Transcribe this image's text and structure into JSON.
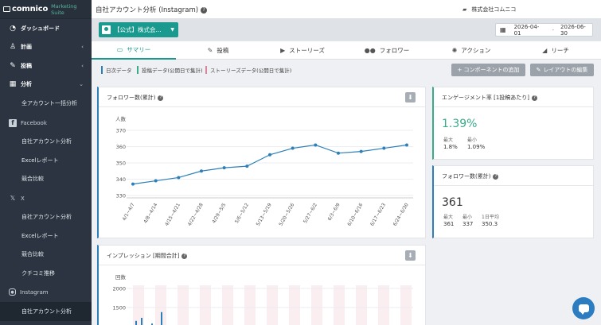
{
  "sidebar": {
    "logo": "comnico",
    "logo_sub": "Marketing Suite",
    "items": [
      {
        "label": "ダッシュボード",
        "icon": "dashboard-icon"
      },
      {
        "label": "計画",
        "icon": "plan-icon"
      },
      {
        "label": "投稿",
        "icon": "post-icon"
      },
      {
        "label": "分析",
        "icon": "analytics-icon"
      },
      {
        "label": "全アカウント一括分析"
      },
      {
        "label": "Facebook",
        "icon": "facebook-icon"
      },
      {
        "label": "自社アカウント分析"
      },
      {
        "label": "Excelレポート"
      },
      {
        "label": "競合比較"
      },
      {
        "label": "X",
        "icon": "x-icon"
      },
      {
        "label": "自社アカウント分析"
      },
      {
        "label": "Excelレポート"
      },
      {
        "label": "競合比較"
      },
      {
        "label": "クチコミ推移"
      },
      {
        "label": "Instagram",
        "icon": "instagram-icon"
      },
      {
        "label": "自社アカウント分析"
      }
    ]
  },
  "header": {
    "title": "自社アカウント分析 (Instagram)",
    "company": "株式会社コムニコ"
  },
  "toolbar": {
    "account_label": "【公式】株式会...",
    "date_from": "2026-04-01",
    "date_sep": "-",
    "date_to": "2026-06-30"
  },
  "tabs": [
    {
      "label": "サマリー",
      "icon": "summary-icon"
    },
    {
      "label": "投稿",
      "icon": "post-tab-icon"
    },
    {
      "label": "ストーリーズ",
      "icon": "play-icon"
    },
    {
      "label": "フォロワー",
      "icon": "users-icon"
    },
    {
      "label": "アクション",
      "icon": "action-icon"
    },
    {
      "label": "リーチ",
      "icon": "megaphone-icon"
    }
  ],
  "legend": {
    "daily": "日次データ",
    "post": "投稿データ(公開日で集計)",
    "stories": "ストーリーズデータ(公開日で集計)"
  },
  "buttons": {
    "add_component": "+ コンポーネントの追加",
    "edit_layout": "レイアウトの編集"
  },
  "followers_panel": {
    "title": "フォロワー数(累計)"
  },
  "impressions_panel": {
    "title": "インプレッション [期間合計]"
  },
  "engagement_panel": {
    "title": "エンゲージメント率 [1投稿あたり]",
    "value": "1.39%",
    "max_label": "最大",
    "max_value": "1.8%",
    "min_label": "最小",
    "min_value": "1.09%"
  },
  "follower_count_panel": {
    "title": "フォロワー数(累計)",
    "value": "361",
    "max_label": "最大",
    "max_value": "361",
    "min_label": "最小",
    "min_value": "337",
    "avg_label": "1日平均",
    "avg_value": "350.3"
  },
  "colors": {
    "brand": "#1a9a8f",
    "sidebar": "#2b3440",
    "line": "#2c7fb8",
    "bar": "#2c7fb8"
  },
  "chart_data": [
    {
      "type": "line",
      "title": "フォロワー数(累計)",
      "ylabel": "人数",
      "ylim": [
        330,
        370
      ],
      "yticks": [
        330,
        340,
        350,
        360,
        370
      ],
      "categories": [
        "4/1~4/7",
        "4/8~4/14",
        "4/15~4/21",
        "4/22~4/28",
        "4/29~5/5",
        "5/6~5/12",
        "5/13~5/19",
        "5/20~5/26",
        "5/27~6/2",
        "6/3~6/9",
        "6/10~6/16",
        "6/17~6/23",
        "6/24~6/30"
      ],
      "series": [
        {
          "values": [
            337,
            339,
            341,
            345,
            347,
            348,
            355,
            359,
            361,
            356,
            357,
            359,
            361
          ]
        }
      ],
      "grid": true
    },
    {
      "type": "bar",
      "title": "インプレッション [期間合計]",
      "ylabel": "回数",
      "yticks": [
        1500,
        2000
      ],
      "visible_values": [
        1150,
        1230,
        1080,
        1380
      ]
    }
  ]
}
